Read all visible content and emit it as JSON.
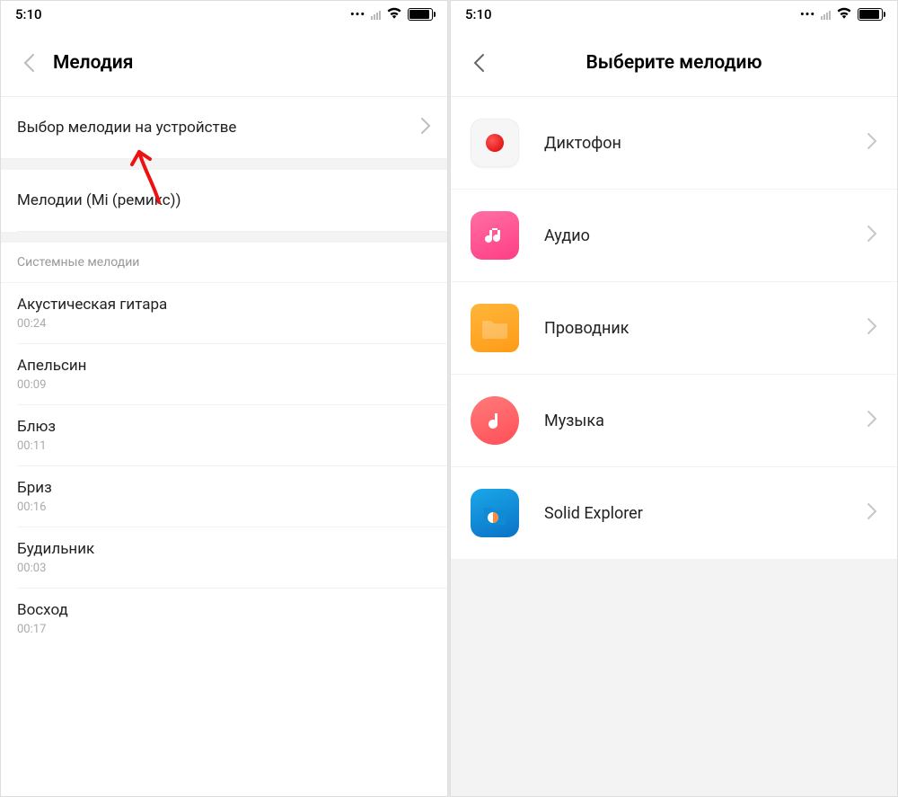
{
  "status": {
    "time": "5:10"
  },
  "left": {
    "title": "Мелодия",
    "chooseOnDevice": "Выбор мелодии на устройстве",
    "remix": "Мелодии (Mi (ремикс))",
    "sectionTitle": "Системные мелодии",
    "songs": [
      {
        "title": "Акустическая гитара",
        "duration": "00:24"
      },
      {
        "title": "Апельсин",
        "duration": "00:09"
      },
      {
        "title": "Блюз",
        "duration": "00:11"
      },
      {
        "title": "Бриз",
        "duration": "00:16"
      },
      {
        "title": "Будильник",
        "duration": "00:03"
      },
      {
        "title": "Восход",
        "duration": "00:17"
      }
    ]
  },
  "right": {
    "title": "Выберите мелодию",
    "apps": [
      {
        "label": "Диктофон"
      },
      {
        "label": "Аудио"
      },
      {
        "label": "Проводник"
      },
      {
        "label": "Музыка"
      },
      {
        "label": "Solid Explorer"
      }
    ]
  }
}
